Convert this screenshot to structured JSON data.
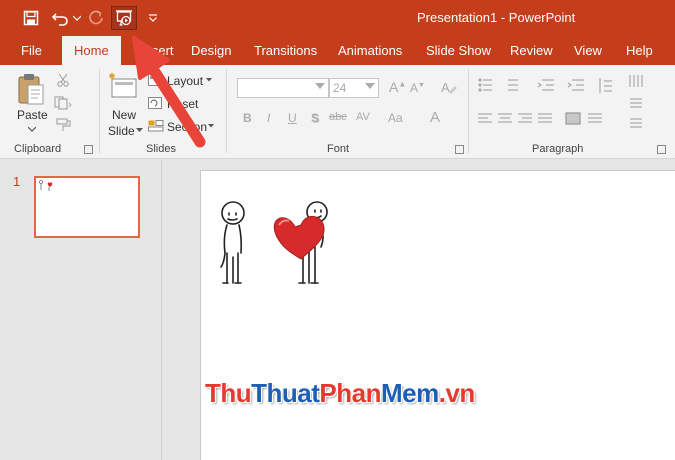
{
  "window": {
    "title": "Presentation1  -  PowerPoint"
  },
  "qat": {
    "icons": [
      "save-icon",
      "undo-icon",
      "undo-dropdown-icon",
      "redo-icon",
      "start-from-beginning-icon",
      "customize-qat-icon"
    ]
  },
  "tabs": [
    {
      "label": "File"
    },
    {
      "label": "Home"
    },
    {
      "label": "Insert"
    },
    {
      "label": "Design"
    },
    {
      "label": "Transitions"
    },
    {
      "label": "Animations"
    },
    {
      "label": "Slide Show"
    },
    {
      "label": "Review"
    },
    {
      "label": "View"
    },
    {
      "label": "Help"
    }
  ],
  "ribbon": {
    "clipboard": {
      "paste_label": "Paste",
      "group_label": "Clipboard"
    },
    "slides": {
      "new_slide_line1": "New",
      "new_slide_line2": "Slide",
      "layout_label": "Layout",
      "reset_label": "Reset",
      "section_label": "Section",
      "group_label": "Slides"
    },
    "font": {
      "font_name_value": "",
      "font_size_value": "24",
      "group_label": "Font",
      "buttons": [
        "B",
        "I",
        "U",
        "S",
        "abc",
        "AV",
        "Aa",
        "A"
      ]
    },
    "paragraph": {
      "group_label": "Paragraph"
    }
  },
  "thumbnails": [
    {
      "number": "1"
    }
  ],
  "watermark": {
    "part1": "Thu",
    "part2": "Thuat",
    "part3": "Phan",
    "part4": "Mem",
    "part5": ".vn"
  },
  "colors": {
    "accent": "#c43e1c",
    "ribbon_bg": "#f3f3f3",
    "arrow": "#e8443a"
  }
}
